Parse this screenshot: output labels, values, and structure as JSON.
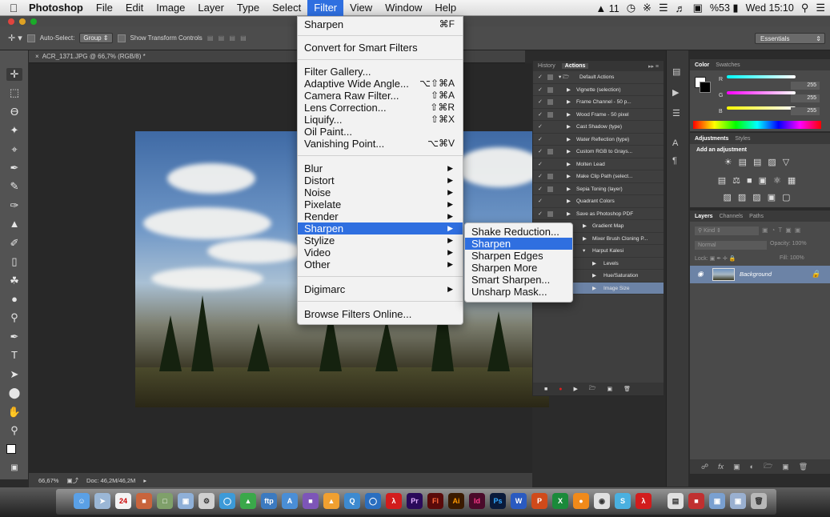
{
  "menubar": {
    "apple_icon": "apple-icon",
    "app_name": "Photoshop",
    "menus": [
      "File",
      "Edit",
      "Image",
      "Layer",
      "Type",
      "Select",
      "Filter",
      "View",
      "Window",
      "Help"
    ],
    "active_menu": "Filter",
    "status": {
      "adobe": "11",
      "battery": "%53",
      "clock": "Wed 15:10"
    }
  },
  "options": {
    "auto_select_label": "Auto-Select:",
    "auto_select_value": "Group",
    "show_transform_label": "Show Transform Controls",
    "workspace": "Essentials"
  },
  "document": {
    "tab": "ACR_1371.JPG @ 66,7% (RGB/8) *",
    "zoom": "66,67%",
    "doc_size": "Doc: 46,2M/46,2M"
  },
  "filter_menu": {
    "items": [
      {
        "label": "Sharpen",
        "shortcut": "⌘F"
      },
      {
        "label": "Convert for Smart Filters"
      },
      {
        "label": "Filter Gallery..."
      },
      {
        "label": "Adaptive Wide Angle...",
        "shortcut": "⌥⇧⌘A"
      },
      {
        "label": "Camera Raw Filter...",
        "shortcut": "⇧⌘A"
      },
      {
        "label": "Lens Correction...",
        "shortcut": "⇧⌘R"
      },
      {
        "label": "Liquify...",
        "shortcut": "⇧⌘X"
      },
      {
        "label": "Oil Paint..."
      },
      {
        "label": "Vanishing Point...",
        "shortcut": "⌥⌘V"
      },
      {
        "label": "Blur"
      },
      {
        "label": "Distort"
      },
      {
        "label": "Noise"
      },
      {
        "label": "Pixelate"
      },
      {
        "label": "Render"
      },
      {
        "label": "Sharpen"
      },
      {
        "label": "Stylize"
      },
      {
        "label": "Video"
      },
      {
        "label": "Other"
      },
      {
        "label": "Digimarc"
      },
      {
        "label": "Browse Filters Online..."
      }
    ]
  },
  "sharpen_submenu": {
    "items": [
      "Shake Reduction...",
      "Sharpen",
      "Sharpen Edges",
      "Sharpen More",
      "Smart Sharpen...",
      "Unsharp Mask..."
    ]
  },
  "actions_panel": {
    "tabs": [
      "History",
      "Actions"
    ],
    "active_tab": "Actions",
    "rows": [
      "Default Actions",
      "Vignette (selection)",
      "Frame Channel - 50 p...",
      "Wood Frame - 50 pixel",
      "Cast Shadow (type)",
      "Water Reflection (type)",
      "Custom RGB to Grays...",
      "Molten Lead",
      "Make Clip Path (select...",
      "Sepia Toning (layer)",
      "Quadrant Colors",
      "Save as Photoshop PDF",
      "Gradient Map",
      "Mixer Brush Cloning P...",
      "Harput Kalesi",
      "Levels",
      "Hue/Saturation",
      "Image Size"
    ]
  },
  "color_panel": {
    "tabs": [
      "Color",
      "Swatches"
    ],
    "channels": [
      {
        "label": "R",
        "value": "255"
      },
      {
        "label": "G",
        "value": "255"
      },
      {
        "label": "B",
        "value": "255"
      }
    ]
  },
  "adjustments_panel": {
    "tabs": [
      "Adjustments",
      "Styles"
    ],
    "heading": "Add an adjustment"
  },
  "layers_panel": {
    "tabs": [
      "Layers",
      "Channels",
      "Paths"
    ],
    "kind": "Kind",
    "blend": "Normal",
    "opacity_label": "Opacity:",
    "opacity": "100%",
    "lock_label": "Lock:",
    "fill_label": "Fill:",
    "fill": "100%",
    "layer_name": "Background"
  },
  "dock_apps": [
    "Pr",
    "Fl",
    "Ai",
    "Id",
    "Ps"
  ]
}
